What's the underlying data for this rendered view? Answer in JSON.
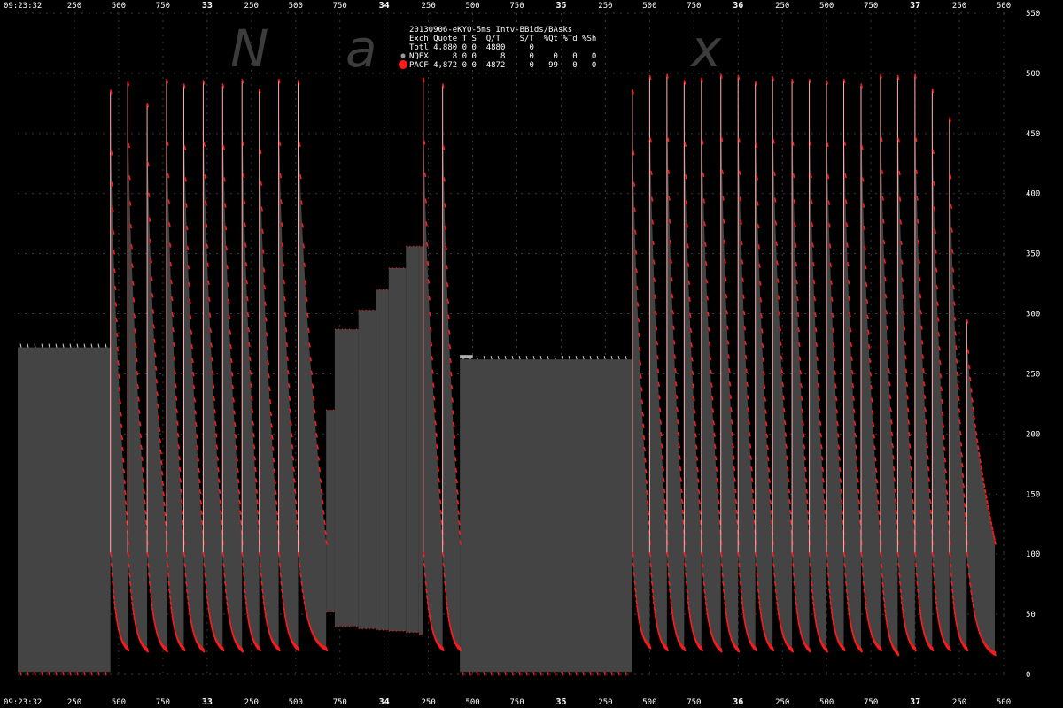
{
  "top_left_time": "09:23:32",
  "bottom_left_time": "09:23:32",
  "watermark_letters": [
    "N",
    "a",
    "x"
  ],
  "legend": {
    "title": "20130906-eKYO-5ms Intv-BBids/BAsks",
    "header": [
      "Exch",
      "Quote",
      "T",
      "S",
      "Q/T",
      "S/T",
      "%Qt",
      "%Td",
      "%Sh"
    ],
    "rows": [
      {
        "name": "Totl",
        "quote": "4,880",
        "t": "0",
        "s": "0",
        "qt": "4880",
        "st": "0",
        "pqt": "",
        "ptd": "",
        "psh": "",
        "marker": "none",
        "color": "#ffffff"
      },
      {
        "name": "NQEX",
        "quote": "8",
        "t": "0",
        "s": "0",
        "qt": "8",
        "st": "0",
        "pqt": "0",
        "ptd": "0",
        "psh": "0",
        "marker": "small",
        "color": "#9a9a9a"
      },
      {
        "name": "PACF",
        "quote": "4,872",
        "t": "0",
        "s": "0",
        "qt": "4872",
        "st": "0",
        "pqt": "99",
        "ptd": "0",
        "psh": "0",
        "marker": "large",
        "color": "#ff1a1a"
      }
    ]
  },
  "chart_data": {
    "type": "area",
    "ylim": [
      0,
      550
    ],
    "yticks": [
      0,
      50,
      100,
      150,
      200,
      250,
      300,
      350,
      400,
      450,
      500,
      550
    ],
    "xticks": [
      {
        "label": "250",
        "strong": false
      },
      {
        "label": "500",
        "strong": false
      },
      {
        "label": "750",
        "strong": false
      },
      {
        "label": "33",
        "strong": true
      },
      {
        "label": "250",
        "strong": false
      },
      {
        "label": "500",
        "strong": false
      },
      {
        "label": "750",
        "strong": false
      },
      {
        "label": "34",
        "strong": true
      },
      {
        "label": "250",
        "strong": false
      },
      {
        "label": "500",
        "strong": false
      },
      {
        "label": "750",
        "strong": false
      },
      {
        "label": "35",
        "strong": true
      },
      {
        "label": "250",
        "strong": false
      },
      {
        "label": "500",
        "strong": false
      },
      {
        "label": "750",
        "strong": false
      },
      {
        "label": "36",
        "strong": true
      },
      {
        "label": "250",
        "strong": false
      },
      {
        "label": "500",
        "strong": false
      },
      {
        "label": "750",
        "strong": false
      },
      {
        "label": "37",
        "strong": true
      },
      {
        "label": "250",
        "strong": false
      },
      {
        "label": "500",
        "strong": false
      }
    ],
    "xlim_seconds": [
      0,
      4.6
    ],
    "flat_blocks": [
      {
        "t0": 0.0,
        "t1": 0.43,
        "bid": 2,
        "ask": 272,
        "note": "initial plateau"
      },
      {
        "t0": 2.05,
        "t1": 2.85,
        "bid": 2,
        "ask": 262,
        "note": "middle plateau"
      }
    ],
    "staircase": {
      "t0": 1.43,
      "t1": 1.88,
      "steps": [
        {
          "t": 1.43,
          "bid": 52,
          "ask": 220
        },
        {
          "t": 1.47,
          "bid": 40,
          "ask": 287
        },
        {
          "t": 1.58,
          "bid": 38,
          "ask": 303
        },
        {
          "t": 1.66,
          "bid": 37,
          "ask": 320
        },
        {
          "t": 1.72,
          "bid": 36,
          "ask": 338
        },
        {
          "t": 1.8,
          "bid": 35,
          "ask": 356
        },
        {
          "t": 1.86,
          "bid": 33,
          "ask": 356
        }
      ]
    },
    "cycles": [
      {
        "t0": 0.43,
        "t1": 0.51,
        "peak": 485,
        "floor": 18
      },
      {
        "t0": 0.51,
        "t1": 0.6,
        "peak": 492,
        "floor": 17
      },
      {
        "t0": 0.6,
        "t1": 0.69,
        "peak": 474,
        "floor": 17
      },
      {
        "t0": 0.69,
        "t1": 0.77,
        "peak": 494,
        "floor": 18
      },
      {
        "t0": 0.77,
        "t1": 0.86,
        "peak": 490,
        "floor": 17
      },
      {
        "t0": 0.86,
        "t1": 0.95,
        "peak": 493,
        "floor": 18
      },
      {
        "t0": 0.95,
        "t1": 1.04,
        "peak": 490,
        "floor": 17
      },
      {
        "t0": 1.04,
        "t1": 1.12,
        "peak": 494,
        "floor": 18
      },
      {
        "t0": 1.12,
        "t1": 1.21,
        "peak": 486,
        "floor": 18
      },
      {
        "t0": 1.21,
        "t1": 1.3,
        "peak": 494,
        "floor": 18
      },
      {
        "t0": 1.3,
        "t1": 1.43,
        "peak": 493,
        "floor": 18
      },
      {
        "t0": 1.88,
        "t1": 1.97,
        "peak": 495,
        "floor": 18
      },
      {
        "t0": 1.97,
        "t1": 2.05,
        "peak": 490,
        "floor": 18
      },
      {
        "t0": 2.85,
        "t1": 2.93,
        "peak": 485,
        "floor": 20
      },
      {
        "t0": 2.93,
        "t1": 3.01,
        "peak": 497,
        "floor": 18
      },
      {
        "t0": 3.01,
        "t1": 3.09,
        "peak": 498,
        "floor": 18
      },
      {
        "t0": 3.09,
        "t1": 3.17,
        "peak": 493,
        "floor": 18
      },
      {
        "t0": 3.17,
        "t1": 3.26,
        "peak": 495,
        "floor": 17
      },
      {
        "t0": 3.26,
        "t1": 3.34,
        "peak": 498,
        "floor": 17
      },
      {
        "t0": 3.34,
        "t1": 3.42,
        "peak": 497,
        "floor": 18
      },
      {
        "t0": 3.42,
        "t1": 3.5,
        "peak": 492,
        "floor": 18
      },
      {
        "t0": 3.5,
        "t1": 3.59,
        "peak": 496,
        "floor": 17
      },
      {
        "t0": 3.59,
        "t1": 3.67,
        "peak": 494,
        "floor": 17
      },
      {
        "t0": 3.67,
        "t1": 3.75,
        "peak": 494,
        "floor": 17
      },
      {
        "t0": 3.75,
        "t1": 3.83,
        "peak": 493,
        "floor": 18
      },
      {
        "t0": 3.83,
        "t1": 3.91,
        "peak": 494,
        "floor": 17
      },
      {
        "t0": 3.91,
        "t1": 4.0,
        "peak": 490,
        "floor": 18
      },
      {
        "t0": 4.0,
        "t1": 4.08,
        "peak": 498,
        "floor": 14
      },
      {
        "t0": 4.08,
        "t1": 4.16,
        "peak": 497,
        "floor": 18
      },
      {
        "t0": 4.16,
        "t1": 4.24,
        "peak": 498,
        "floor": 18
      },
      {
        "t0": 4.24,
        "t1": 4.32,
        "peak": 486,
        "floor": 18
      },
      {
        "t0": 4.32,
        "t1": 4.4,
        "peak": 462,
        "floor": 18
      },
      {
        "t0": 4.4,
        "t1": 4.53,
        "peak": 294,
        "floor": 14
      }
    ],
    "series": [
      {
        "name": "NQEX",
        "color": "#9a9a9a"
      },
      {
        "name": "PACF",
        "color": "#ff1a1a"
      }
    ],
    "colors": {
      "fill": "#444444",
      "bid_ask_marks": "#ff1a1a",
      "nqex_marks": "#b0b0b0",
      "grid": "#3a3a3a",
      "background": "#000000"
    }
  }
}
